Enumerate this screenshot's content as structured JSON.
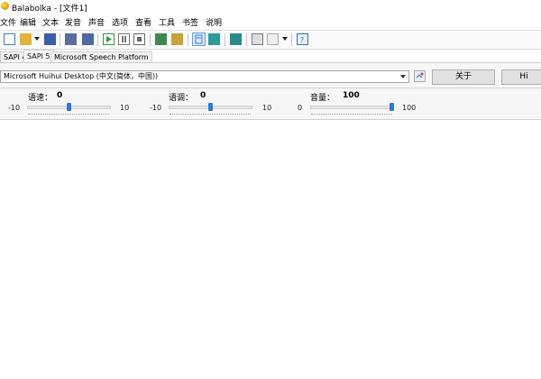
{
  "window": {
    "title": "Balabolka - [文件1]"
  },
  "menu": [
    "文件",
    "编辑",
    "文本",
    "发音",
    "声音",
    "选项",
    "查看",
    "工具",
    "书签",
    "说明"
  ],
  "toolbar": {
    "buttons": [
      {
        "name": "new-document-icon",
        "color": "#3a7fd0"
      },
      {
        "name": "open-folder-icon",
        "color": "#e2b23a"
      },
      {
        "name": "save-icon",
        "color": "#3a5fa8"
      },
      {
        "name": "save-as-audio-icon",
        "color": "#5a6e9a"
      },
      {
        "name": "convert-audio-icon",
        "color": "#4e6aa0"
      },
      {
        "name": "play-icon",
        "color": "#2e9a3a"
      },
      {
        "name": "pause-icon",
        "color": "#7a7a7a"
      },
      {
        "name": "stop-icon",
        "color": "#6a6a6a"
      },
      {
        "name": "read-clipboard-icon",
        "color": "#3c8a4c"
      },
      {
        "name": "clipboard-icon",
        "color": "#c8a23a"
      },
      {
        "name": "view-toggle-icon",
        "color": "#3a7fd0"
      },
      {
        "name": "audio-file-icon",
        "color": "#2e9a9a"
      },
      {
        "name": "split-file-icon",
        "color": "#2e8a8a"
      },
      {
        "name": "export-icon",
        "color": "#7a7a7a"
      },
      {
        "name": "help-icon",
        "color": "#2f6fc8"
      }
    ]
  },
  "tabs": [
    "SAPI 4",
    "SAPI 5",
    "Microsoft Speech Platform"
  ],
  "voice": {
    "selected": "Microsoft Huihui Desktop (中文(简体，中国))",
    "about_label": "关于",
    "other_label": "Hi"
  },
  "sliders": {
    "rate": {
      "label": "语速：",
      "value": "0",
      "min": "-10",
      "max": "10",
      "level": 0.5
    },
    "pitch": {
      "label": "语调：",
      "value": "0",
      "min": "-10",
      "max": "10",
      "level": 0.5
    },
    "volume": {
      "label": "音量：",
      "value": "100",
      "min": "0",
      "max": "100",
      "level": 1.0
    }
  }
}
